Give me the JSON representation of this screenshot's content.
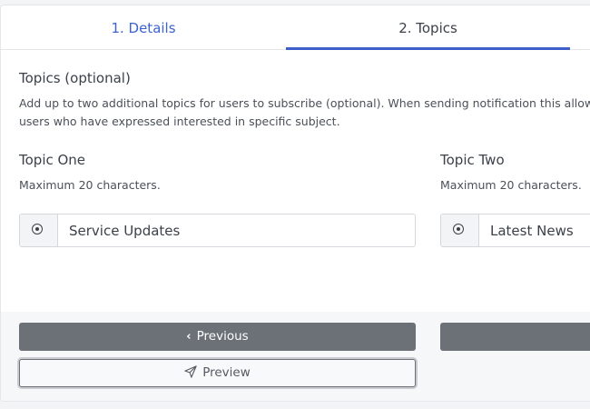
{
  "tabs": [
    {
      "label": "1. Details",
      "active": false
    },
    {
      "label": "2. Topics",
      "active": true
    }
  ],
  "section": {
    "title": "Topics (optional)",
    "description_line1": "Add up to two additional topics for users to subscribe (optional). When sending notification this allows you to s",
    "description_line2": "users who have expressed interested in specific subject."
  },
  "topic_one": {
    "label": "Topic One",
    "help": "Maximum 20 characters.",
    "value": "Service Updates"
  },
  "topic_two": {
    "label": "Topic Two",
    "help": "Maximum 20 characters.",
    "value": "Latest News"
  },
  "buttons": {
    "previous_label": "Previous",
    "preview_label": "Preview"
  },
  "icons": {
    "radio": "radio-target-icon",
    "previous": "chevron-left-icon",
    "preview": "send-paper-plane-icon"
  },
  "colors": {
    "accent": "#3d5fc7",
    "button_dark": "#6c7178"
  }
}
